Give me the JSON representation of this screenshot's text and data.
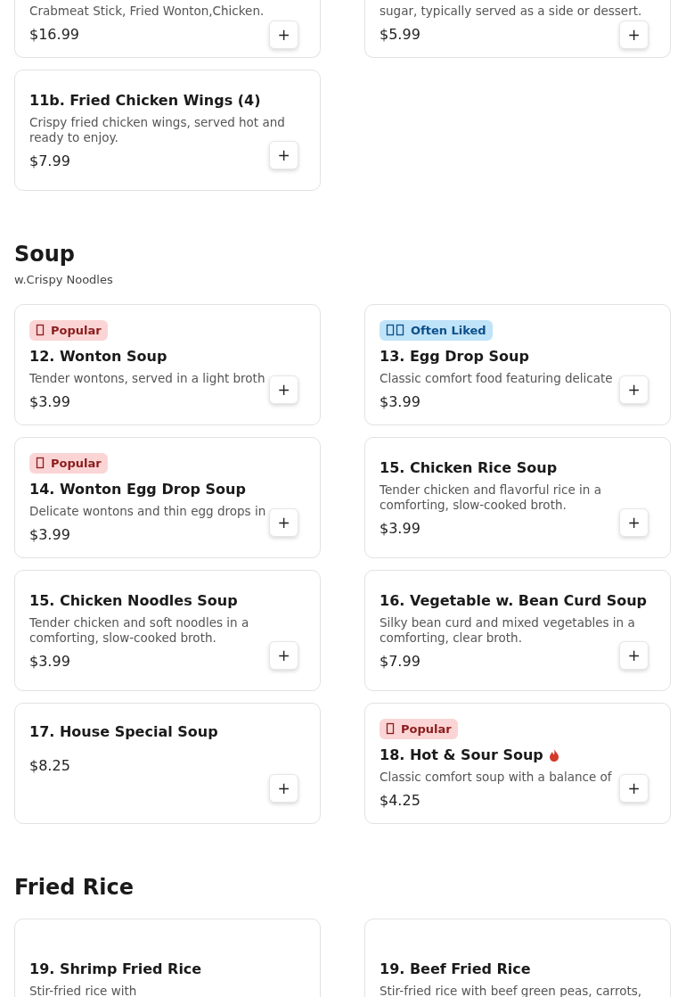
{
  "sections": [
    {
      "items": [
        {
          "description": "Crabmeat Stick, Fried Wonton,Chicken.",
          "price": "$16.99",
          "add": "+"
        },
        {
          "description": "sugar, typically served as a side or dessert.",
          "price": "$5.99",
          "add": "+"
        },
        {
          "title": "11b. Fried Chicken Wings (4)",
          "description": "Crispy fried chicken wings, served hot and ready to enjoy.",
          "price": "$7.99",
          "add": "+"
        }
      ]
    },
    {
      "title": "Soup",
      "subtitle": "w.Crispy Noodles",
      "items": [
        {
          "badge": {
            "kind": "popular",
            "label": "Popular"
          },
          "title": "12. Wonton Soup",
          "description": "Tender wontons, served in a light broth",
          "price": "$3.99",
          "add": "+"
        },
        {
          "badge": {
            "kind": "liked",
            "label": "Often Liked"
          },
          "title": "13. Egg Drop Soup",
          "description": "Classic comfort food featuring delicate",
          "price": "$3.99",
          "add": "+"
        },
        {
          "badge": {
            "kind": "popular",
            "label": "Popular"
          },
          "title": "14. Wonton Egg Drop Soup",
          "description": "Delicate wontons and thin egg drops in",
          "price": "$3.99",
          "add": "+"
        },
        {
          "title": "15. Chicken Rice Soup",
          "description": "Tender chicken and flavorful rice in a comforting, slow-cooked broth.",
          "price": "$3.99",
          "add": "+"
        },
        {
          "title": "15. Chicken Noodles Soup",
          "description": "Tender chicken and soft noodles in a comforting, slow-cooked broth.",
          "price": "$3.99",
          "add": "+"
        },
        {
          "title": "16. Vegetable w. Bean Curd Soup",
          "description": "Silky bean curd and mixed vegetables in a comforting, clear broth.",
          "price": "$7.99",
          "add": "+"
        },
        {
          "title": "17. House Special Soup",
          "price": "$8.25",
          "add": "+"
        },
        {
          "badge": {
            "kind": "popular",
            "label": "Popular"
          },
          "title": "18. Hot & Sour Soup",
          "spicy": true,
          "description": "Classic comfort soup with a balance of",
          "price": "$4.25",
          "add": "+"
        }
      ]
    },
    {
      "title": "Fried Rice",
      "items": [
        {
          "title": "19. Shrimp Fried Rice",
          "description": "Stir-fried rice with"
        },
        {
          "title": "19. Beef Fried Rice",
          "description": "Stir-fried rice with beef green peas, carrots,"
        }
      ]
    }
  ]
}
